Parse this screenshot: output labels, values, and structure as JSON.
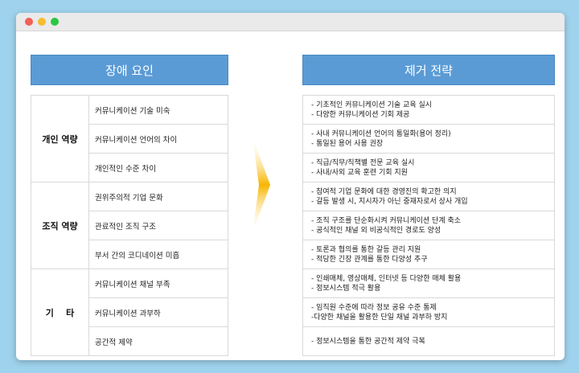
{
  "window": {
    "dot_colors": [
      "#f25f57",
      "#f6bd2f",
      "#2bc840"
    ]
  },
  "left": {
    "header": "장애 요인",
    "groups": [
      {
        "category": "개인 역량",
        "items": [
          "커뮤니케이션 기술 미숙",
          "커뮤니케이션 언어의 차이",
          "개인적인 수준 차이"
        ]
      },
      {
        "category": "조직 역량",
        "items": [
          "권위주의적 기업 문화",
          "관료적인 조직 구조",
          "부서 간의 코디네이션 미흡"
        ]
      },
      {
        "category": "기    타",
        "items": [
          "커뮤니케이션 채널 부족",
          "커뮤니케이션 과부하",
          "공간적 제약"
        ]
      }
    ]
  },
  "right": {
    "header": "제거 전략",
    "rows": [
      [
        "- 기초적인 커뮤니케이션 기술 교육 실시",
        "- 다양한 커뮤니케이션 기회 제공"
      ],
      [
        "- 사내 커뮤니케이션 언어의 통일화(용어 정리)",
        "- 통일된 용어 사용 권장"
      ],
      [
        "- 직급/직무/직책별 전문 교육 실시",
        "- 사내/사외 교육 훈련 기회 지원"
      ],
      [
        "- 참여적 기업 문화에 대한 경영진의 확고한 의지",
        "- 갈등 발생 시, 지시자가 아닌 중재자로서 상사 개입"
      ],
      [
        "- 조직 구조를 단순화시켜 커뮤니케이션 단계 축소",
        "- 공식적인 채널 외 비공식적인 경로도 양성"
      ],
      [
        "- 토론과 협의를 통한 갈등 관리 지원",
        "- 적당한 긴장 관계를 통한 다양성 추구"
      ],
      [
        "- 인쇄매체, 영상매체, 인터넷 등 다양한 매체 활용",
        "- 정보시스템 적극 활용"
      ],
      [
        "- 임직원 수준에 따라 정보 공유 수준 통제",
        "-다양한 채널을 활용한 단일 채널 과부하 방지"
      ],
      [
        "- 정보시스템을 통한 공간적 제약 극복"
      ]
    ]
  }
}
